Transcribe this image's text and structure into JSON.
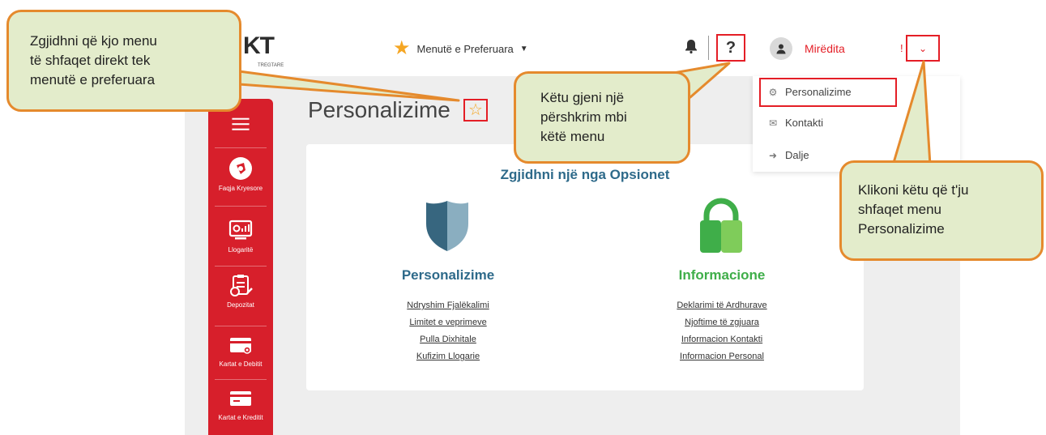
{
  "header": {
    "logo_text": "KT",
    "logo_sub": "TREGTARE",
    "favorites_label": "Menutë e Preferuara",
    "help_label": "?",
    "greeting": "Mirëdita",
    "greeting_suffix": "!"
  },
  "dropdown": {
    "items": [
      {
        "icon": "gear-icon",
        "label": "Personalizime"
      },
      {
        "icon": "envelope-icon",
        "label": "Kontakti"
      },
      {
        "icon": "sign-out-icon",
        "label": "Dalje"
      }
    ]
  },
  "sidebar": {
    "items": [
      {
        "icon": "home-icon",
        "label": "Faqja Kryesore"
      },
      {
        "icon": "accounts-icon",
        "label": "Llogaritë"
      },
      {
        "icon": "deposits-icon",
        "label": "Depozitat"
      },
      {
        "icon": "debit-card-icon",
        "label": "Kartat e Debitit"
      },
      {
        "icon": "credit-card-icon",
        "label": "Kartat e Kreditit"
      }
    ]
  },
  "page": {
    "title": "Personalizime",
    "card_title": "Zgjidhni një nga Opsionet",
    "sections": [
      {
        "heading": "Personalizime",
        "color": "#2e6a8a",
        "links": [
          "Ndryshim Fjalëkalimi",
          "Limitet e veprimeve",
          "Pulla Dixhitale",
          "Kufizim Llogarie"
        ]
      },
      {
        "heading": "Informacione",
        "color": "#3fae49",
        "links": [
          "Deklarimi të Ardhurave",
          "Njoftime të zgjuara",
          "Informacion Kontakti",
          "Informacion Personal"
        ]
      }
    ]
  },
  "callouts": {
    "favorite": [
      "Zgjidhni që kjo menu",
      "të shfaqet direkt tek",
      "menutë e preferuara"
    ],
    "help": [
      "Këtu gjeni një",
      "përshkrim mbi",
      "këtë menu"
    ],
    "personalize": [
      "Klikoni këtu që t'ju",
      "shfaqet menu",
      "Personalizime"
    ]
  },
  "colors": {
    "brand_red": "#d71f2b",
    "highlight_red": "#e41e26",
    "callout_fill": "#e3eccb",
    "callout_border": "#e58a2d",
    "star": "#f5a623"
  }
}
